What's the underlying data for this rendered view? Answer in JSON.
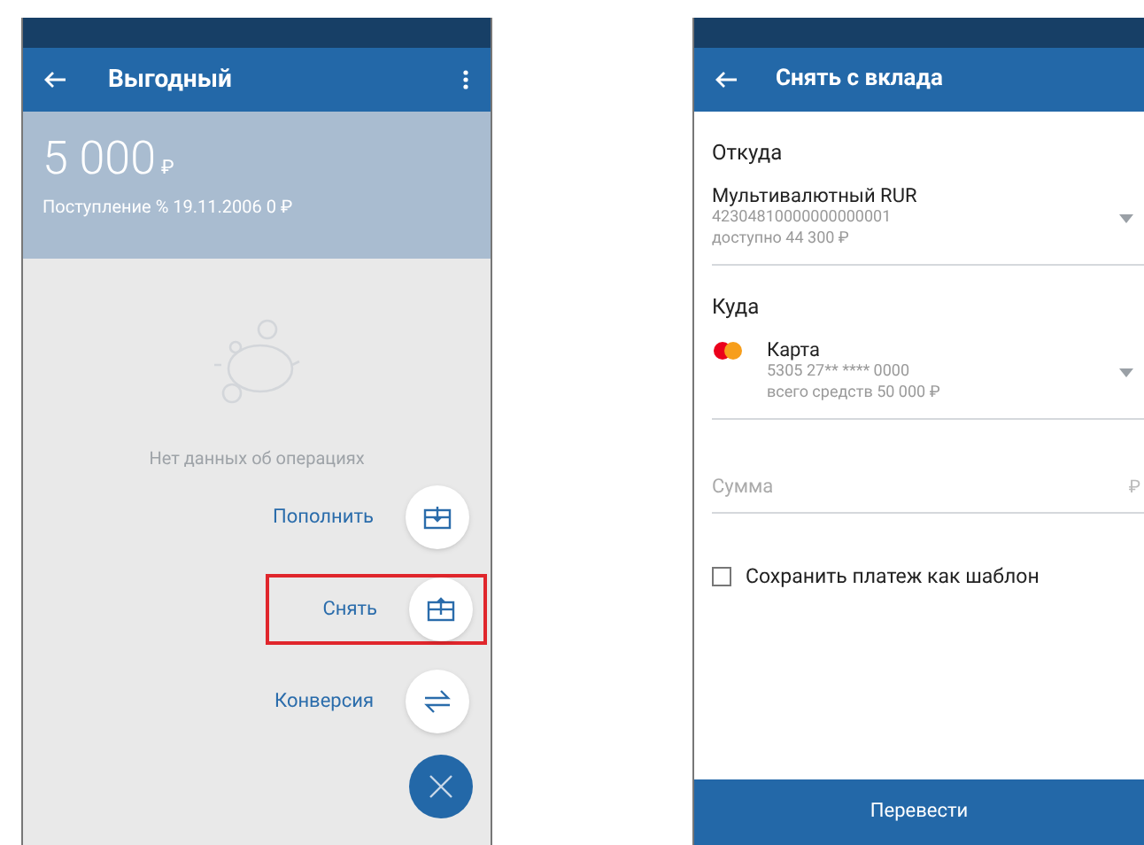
{
  "left_screen": {
    "app_bar": {
      "title": "Выгодный"
    },
    "balance": {
      "amount": "5 000",
      "currency": "₽",
      "note": "Поступление % 19.11.2006 0 ₽"
    },
    "empty_message": "Нет данных об операциях",
    "actions": [
      {
        "kind": "deposit",
        "label": "Пополнить",
        "highlighted": false
      },
      {
        "kind": "withdraw",
        "label": "Снять",
        "highlighted": true
      },
      {
        "kind": "convert",
        "label": "Конверсия",
        "highlighted": false
      }
    ]
  },
  "right_screen": {
    "app_bar": {
      "title": "Снять с вклада"
    },
    "from": {
      "label": "Откуда",
      "name": "Мультивалютный RUR",
      "number": "42304810000000000001",
      "detail": "доступно 44 300 ₽"
    },
    "to": {
      "label": "Куда",
      "name": "Карта",
      "number": "5305 27** **** 0000",
      "detail": "всего средств 50 000 ₽"
    },
    "amount": {
      "placeholder": "Сумма",
      "currency": "₽"
    },
    "save_template": {
      "label": "Сохранить платеж как шаблон",
      "checked": false
    },
    "submit": "Перевести"
  }
}
